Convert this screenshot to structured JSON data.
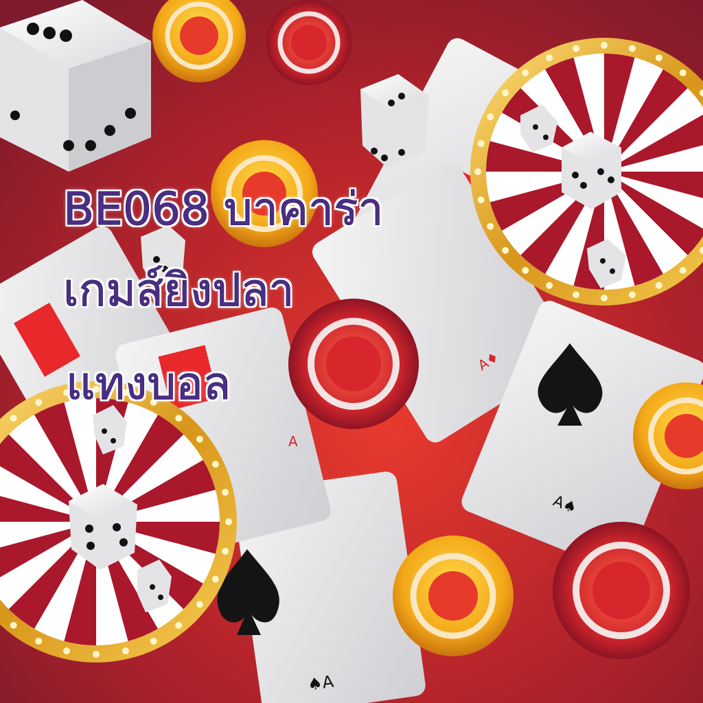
{
  "headline": {
    "line1": "BE068 บาคาร่า",
    "line2": "เกมส์ยิงปลา",
    "line3": "แทงบอล"
  },
  "colors": {
    "background": "#a3202a",
    "headline_text": "#4b2f86",
    "headline_outline": "#ffffff",
    "wheel_rim": "#e0a41c",
    "wheel_red": "#a9182b",
    "chip_gold": "#f3b21a"
  },
  "icons": [
    "dice-icon",
    "poker-chip-icon",
    "roulette-wheel-icon",
    "playing-card-icon",
    "spade-icon"
  ]
}
